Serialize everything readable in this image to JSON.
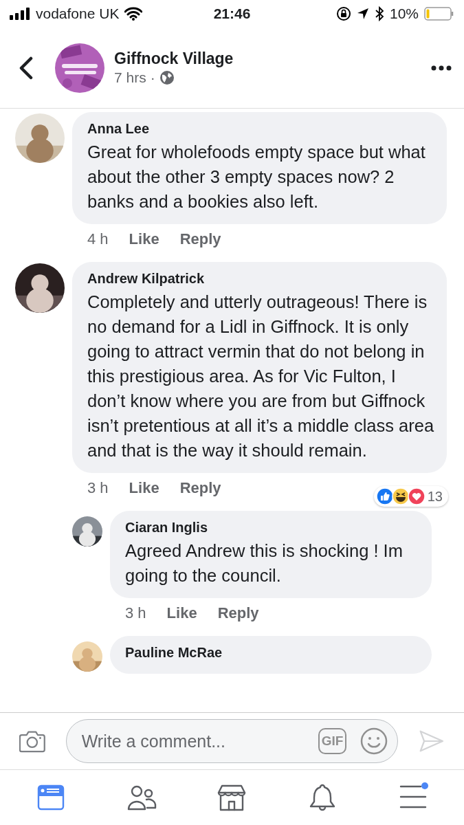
{
  "status_bar": {
    "carrier": "vodafone UK",
    "time": "21:46",
    "battery_text": "10%"
  },
  "header": {
    "title": "Giffnock Village",
    "age": "7 hrs",
    "separator": "·"
  },
  "comments": [
    {
      "name": "Anna Lee",
      "text": "Great for wholefoods empty space but what about the other 3 empty spaces now? 2 banks and a bookies also left.",
      "time": "4 h",
      "actions": [
        "Like",
        "Reply"
      ]
    },
    {
      "name": "Andrew Kilpatrick",
      "text": "Completely and utterly outrageous! There is no demand for a Lidl in Giffnock. It is only going to attract vermin that do not belong in this prestigious area. As for Vic Fulton, I don’t know where you are from but Giffnock isn’t pretentious at all it’s a middle class area and that is the way it should remain.",
      "time": "3 h",
      "actions": [
        "Like",
        "Reply"
      ],
      "reactions": {
        "types": [
          {
            "kind": "like"
          },
          {
            "kind": "haha"
          },
          {
            "kind": "love"
          }
        ],
        "count": "13"
      },
      "replies": [
        {
          "name": "Ciaran Inglis",
          "text": "Agreed Andrew this is shocking ! Im going to the council.",
          "time": "3 h",
          "actions": [
            "Like",
            "Reply"
          ]
        },
        {
          "name": "Pauline McRae"
        }
      ]
    }
  ],
  "composer": {
    "placeholder": "Write a comment...",
    "gif": "GIF"
  },
  "tabs": [
    {
      "kind": "news",
      "selected": true,
      "badge": false
    },
    {
      "kind": "friends",
      "selected": false,
      "badge": false
    },
    {
      "kind": "market",
      "selected": false,
      "badge": false
    },
    {
      "kind": "bell",
      "selected": false,
      "badge": false
    },
    {
      "kind": "menu",
      "selected": false,
      "badge": true
    }
  ]
}
